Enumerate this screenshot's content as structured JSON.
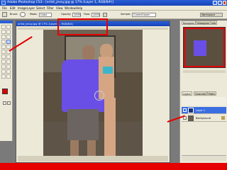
{
  "window_title": "Adobe Photoshop CS3 - [orlist_jessy.jpg @ 17% (Layer 1, RGB/8#)]",
  "menu": [
    "File",
    "Edit",
    "Image",
    "Layer",
    "Select",
    "Filter",
    "View",
    "Window",
    "Help"
  ],
  "options": {
    "brush_label": "Brush:",
    "mode_label": "Mode:",
    "mode_value": "Color",
    "opacity_label": "Opacity:",
    "opacity_value": "100%",
    "flow_label": "Flow:",
    "flow_value": "100%",
    "sample_label": "Sample:",
    "sample_value": "Current layer",
    "workspace_label": "Workspace"
  },
  "document": {
    "title": "orlist_jessy.jpg @ 17% (Layer 1, RGB/8#)"
  },
  "panels": {
    "nav_tabs": [
      "Navigator",
      "Histogram",
      "Info"
    ],
    "layer_tabs": [
      "Layers",
      "Channels",
      "Paths"
    ],
    "layers": [
      {
        "name": "Layer 1"
      },
      {
        "name": "Background"
      }
    ]
  },
  "colors": {
    "titlebar": "#1f4fcc",
    "highlight_red": "#e60000",
    "selected_layer": "#3a6ee0",
    "purple_overlay": "#6a4fe6"
  }
}
